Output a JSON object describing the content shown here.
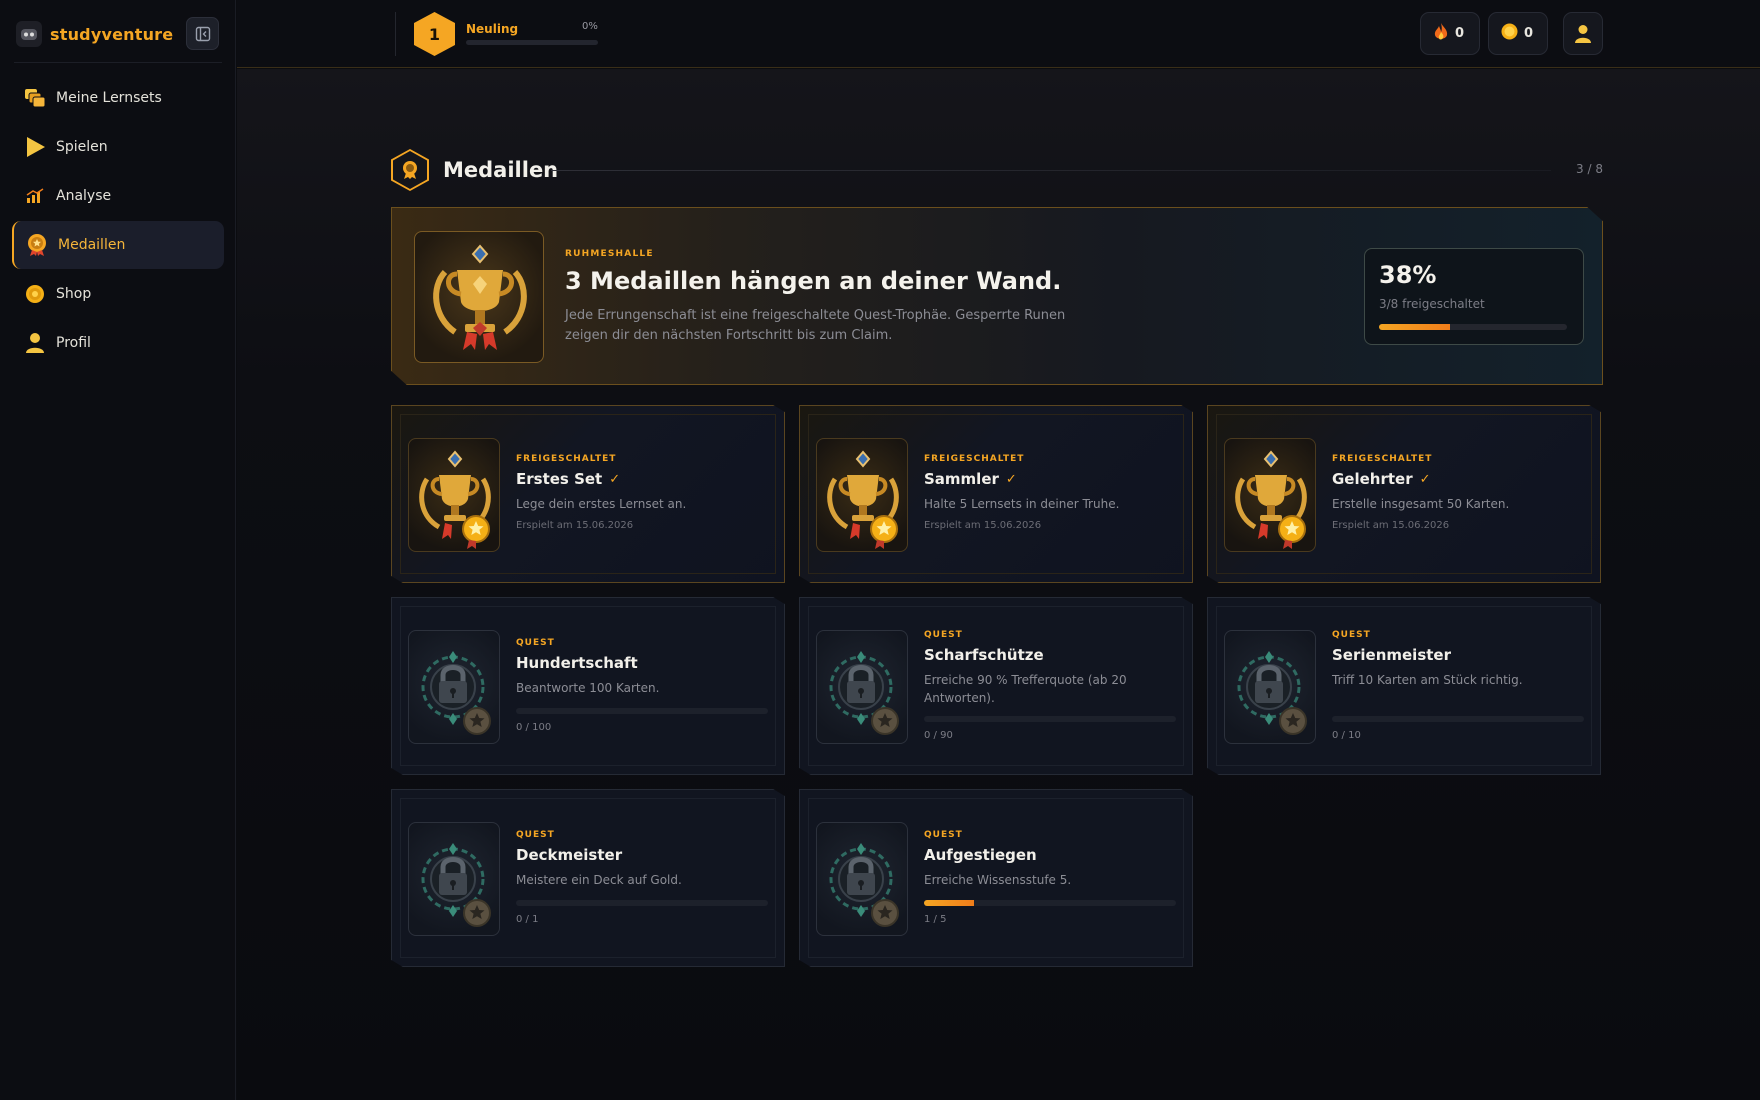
{
  "brand": {
    "name": "studyventure"
  },
  "sidebar": {
    "items": [
      {
        "label": "Meine Lernsets",
        "icon": "cards-stack-icon",
        "active": false
      },
      {
        "label": "Spielen",
        "icon": "play-icon",
        "active": false
      },
      {
        "label": "Analyse",
        "icon": "bar-chart-icon",
        "active": false
      },
      {
        "label": "Medaillen",
        "icon": "medal-icon",
        "active": true
      },
      {
        "label": "Shop",
        "icon": "coin-icon",
        "active": false
      },
      {
        "label": "Profil",
        "icon": "user-icon",
        "active": false
      }
    ]
  },
  "topbar": {
    "level": "1",
    "level_name": "Neuling",
    "level_pct_text": "0%",
    "level_progress": 0,
    "streak": "0",
    "coins": "0"
  },
  "section": {
    "title": "Medaillen",
    "count": "3 / 8"
  },
  "hero": {
    "eyebrow": "RUHMESHALLE",
    "title": "3 Medaillen hängen an deiner Wand.",
    "description": "Jede Errungenschaft ist eine freigeschaltete Quest-Trophäe. Gesperrte Runen zeigen dir den nächsten Fortschritt bis zum Claim.",
    "percent": "38%",
    "subtitle": "3/8 freigeschaltet",
    "progress": 0.38
  },
  "medals": [
    {
      "status": "FREIGESCHALTET",
      "name": "Erstes Set",
      "description": "Lege dein erstes Lernset an.",
      "date": "Erspielt am 15.06.2026",
      "unlocked": true
    },
    {
      "status": "FREIGESCHALTET",
      "name": "Sammler",
      "description": "Halte 5 Lernsets in deiner Truhe.",
      "date": "Erspielt am 15.06.2026",
      "unlocked": true
    },
    {
      "status": "FREIGESCHALTET",
      "name": "Gelehrter",
      "description": "Erstelle insgesamt 50 Karten.",
      "date": "Erspielt am 15.06.2026",
      "unlocked": true
    },
    {
      "status": "QUEST",
      "name": "Hundertschaft",
      "description": "Beantworte 100 Karten.",
      "progress_text": "0 / 100",
      "progress": 0,
      "unlocked": false
    },
    {
      "status": "QUEST",
      "name": "Scharfschütze",
      "description": "Erreiche 90 % Trefferquote (ab 20 Antworten).",
      "progress_text": "0 / 90",
      "progress": 0,
      "unlocked": false
    },
    {
      "status": "QUEST",
      "name": "Serienmeister",
      "description": "Triff 10 Karten am Stück richtig.",
      "progress_text": "0 / 10",
      "progress": 0,
      "unlocked": false
    },
    {
      "status": "QUEST",
      "name": "Deckmeister",
      "description": "Meistere ein Deck auf Gold.",
      "progress_text": "0 / 1",
      "progress": 0,
      "unlocked": false
    },
    {
      "status": "QUEST",
      "name": "Aufgestiegen",
      "description": "Erreiche Wissensstufe 5.",
      "progress_text": "1 / 5",
      "progress": 0.2,
      "unlocked": false
    }
  ]
}
